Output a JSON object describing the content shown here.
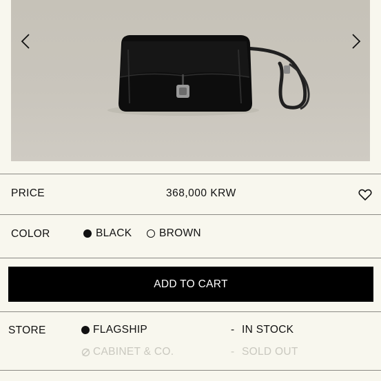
{
  "gallery": {
    "prev_icon": "chevron-left-icon",
    "next_icon": "chevron-right-icon"
  },
  "price": {
    "label": "PRICE",
    "value": "368,000 KRW",
    "wishlist_icon": "heart-icon"
  },
  "color": {
    "label": "COLOR",
    "options": [
      {
        "label": "BLACK",
        "selected": true
      },
      {
        "label": "BROWN",
        "selected": false
      }
    ]
  },
  "cart": {
    "label": "ADD TO CART"
  },
  "store": {
    "label": "STORE",
    "locations": [
      {
        "name": "FLAGSHIP",
        "sep": "-",
        "status": "IN STOCK",
        "available": true
      },
      {
        "name": "CABINET & CO.",
        "sep": "-",
        "status": "SOLD OUT",
        "available": false
      }
    ]
  },
  "colors": {
    "background": "#f8f7ee",
    "button": "#000000",
    "disabled": "#c9c8bf"
  }
}
